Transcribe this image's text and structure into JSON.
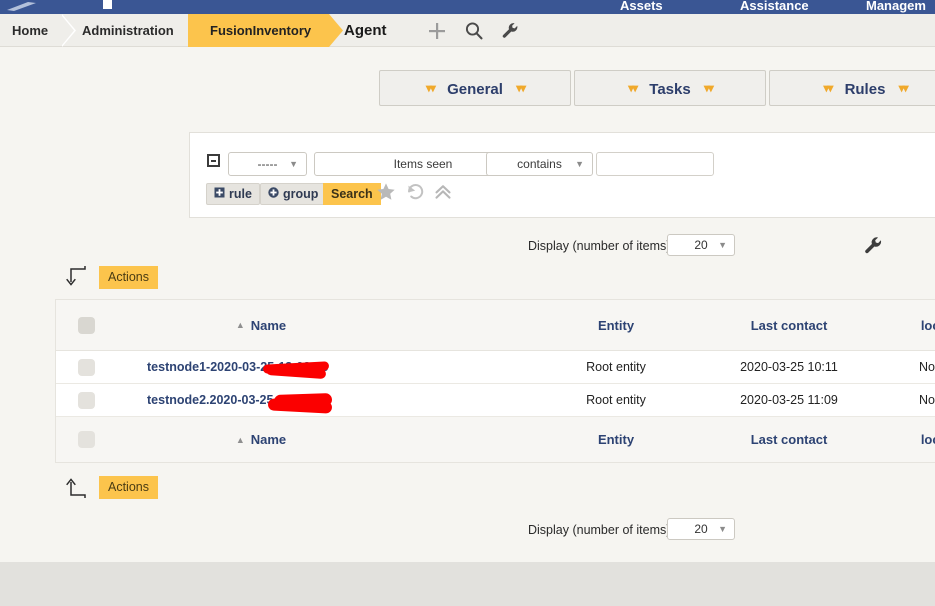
{
  "topbar": {
    "background": "#3a5694",
    "logo_icon": "glpi-logo-icon",
    "menu": [
      {
        "label": "Assets"
      },
      {
        "label": "Assistance"
      },
      {
        "label": "Managem"
      }
    ]
  },
  "breadcrumb": {
    "items": [
      {
        "label": "Home",
        "active": false
      },
      {
        "label": "Administration",
        "active": false
      },
      {
        "label": "FusionInventory",
        "active": true
      }
    ],
    "page_title": "Agent",
    "accent": "#fcc44c",
    "icons": [
      {
        "name": "plus-icon"
      },
      {
        "name": "search-icon"
      },
      {
        "name": "wrench-icon"
      }
    ]
  },
  "tabs": [
    {
      "label": "General"
    },
    {
      "label": "Tasks"
    },
    {
      "label": "Rules"
    }
  ],
  "search_panel": {
    "collapse_icon": "collapse-minus-icon",
    "link_operator": {
      "value": "-----",
      "caret": "▼"
    },
    "field": {
      "value": "Items seen",
      "caret": "▼"
    },
    "operator": {
      "value": "contains",
      "caret": "▼"
    },
    "value_input": {
      "value": "",
      "placeholder": ""
    },
    "add_rule_label": "rule",
    "add_group_label": "group",
    "search_label": "Search",
    "icons": [
      {
        "name": "star-icon"
      },
      {
        "name": "undo-icon"
      },
      {
        "name": "chevron-double-up-icon"
      }
    ]
  },
  "display_top": {
    "label": "Display (number of items)",
    "count": "20",
    "caret": "▼"
  },
  "display_bottom": {
    "label": "Display (number of items)",
    "count": "20",
    "caret": "▼"
  },
  "actions_top": {
    "label": "Actions",
    "arrow_icon": "arrow-down-hook-icon"
  },
  "actions_bottom": {
    "label": "Actions",
    "arrow_icon": "arrow-up-hook-icon"
  },
  "config_wrench": {
    "name": "wrench-icon"
  },
  "table": {
    "columns": [
      {
        "key": "check",
        "label": ""
      },
      {
        "key": "name",
        "label": "Name",
        "sorted": "asc",
        "sort_glyph": "▲"
      },
      {
        "key": "entity",
        "label": "Entity"
      },
      {
        "key": "last_contact",
        "label": "Last contact"
      },
      {
        "key": "locked",
        "label": "locked"
      }
    ],
    "rows": [
      {
        "name_prefix": "testnode1",
        "name_suffix": "-2020-03-25-13-08-36",
        "redacted": true,
        "entity": "Root entity",
        "last_contact": "2020-03-25 10:11",
        "locked": "No"
      },
      {
        "name_prefix": "testnode2.",
        "name_suffix": "2020-03-25-14-05-18",
        "redacted": true,
        "entity": "Root entity",
        "last_contact": "2020-03-25 11:09",
        "locked": "No"
      }
    ]
  },
  "colors": {
    "accent_orange": "#fcc44c",
    "header_blue": "#3a5694",
    "link_blue": "#2d4373",
    "page_bg": "#f6f5f1",
    "footer_bg": "#e2e1dd",
    "redaction_red": "#fb0000"
  }
}
